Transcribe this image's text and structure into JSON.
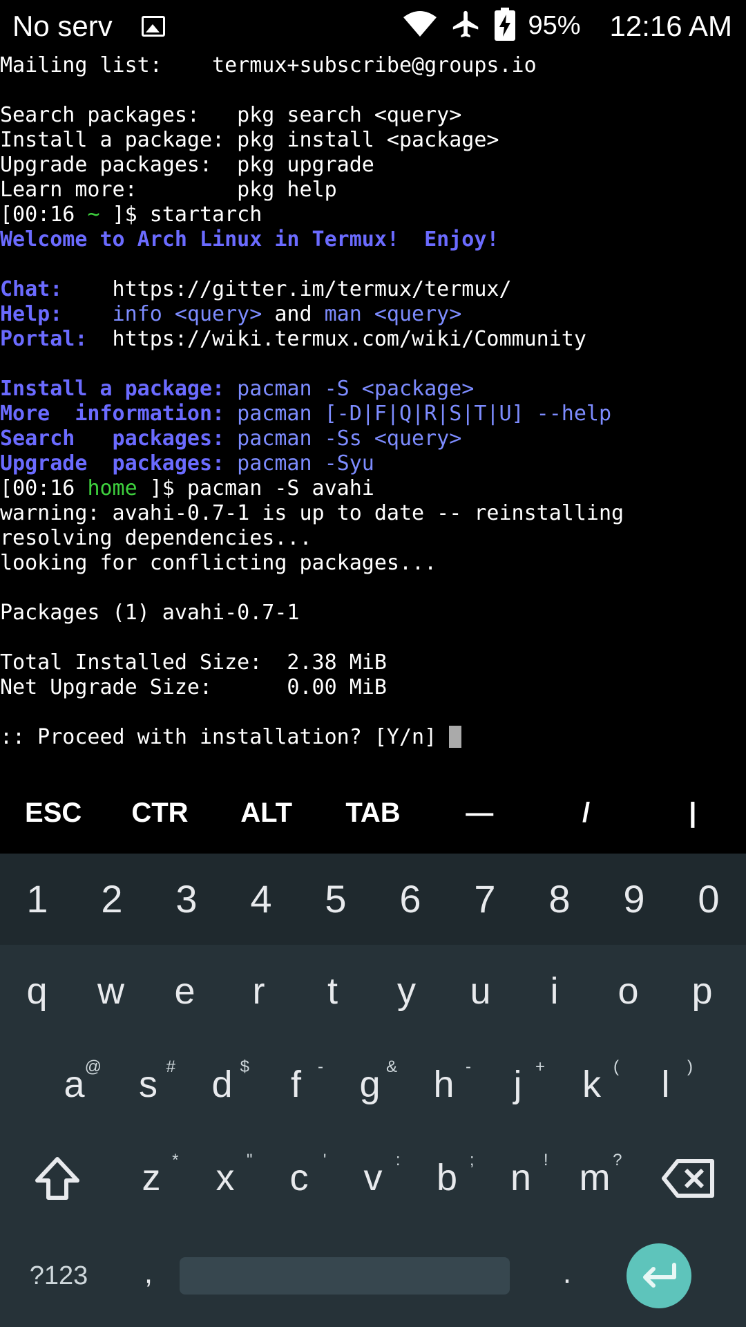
{
  "status_bar": {
    "carrier": "No service",
    "battery_percent": "95%",
    "time": "12:16 AM",
    "icons": [
      "image-icon",
      "wifi-icon",
      "airplane-icon",
      "battery-charging-icon"
    ]
  },
  "terminal": {
    "lines": [
      [
        {
          "t": "Mailing list:    termux+subscribe@groups.io",
          "c": ""
        }
      ],
      [
        {
          "t": "",
          "c": ""
        }
      ],
      [
        {
          "t": "Search packages:   pkg search <query>",
          "c": ""
        }
      ],
      [
        {
          "t": "Install a package: pkg install <package>",
          "c": ""
        }
      ],
      [
        {
          "t": "Upgrade packages:  pkg upgrade",
          "c": ""
        }
      ],
      [
        {
          "t": "Learn more:        pkg help",
          "c": ""
        }
      ],
      [
        {
          "t": "[00:16 ",
          "c": ""
        },
        {
          "t": "~",
          "c": "c-green"
        },
        {
          "t": " ]$ startarch",
          "c": ""
        }
      ],
      [
        {
          "t": "Welcome to Arch Linux in Termux!  Enjoy!",
          "c": "c-blue"
        }
      ],
      [
        {
          "t": "",
          "c": ""
        }
      ],
      [
        {
          "t": "Chat:",
          "c": "c-blue"
        },
        {
          "t": "    https://gitter.im/termux/termux/",
          "c": ""
        }
      ],
      [
        {
          "t": "Help:",
          "c": "c-blue"
        },
        {
          "t": "    ",
          "c": ""
        },
        {
          "t": "info <query>",
          "c": "c-lblue"
        },
        {
          "t": " and ",
          "c": ""
        },
        {
          "t": "man <query>",
          "c": "c-lblue"
        }
      ],
      [
        {
          "t": "Portal:",
          "c": "c-blue"
        },
        {
          "t": "  https://wiki.termux.com/wiki/Community",
          "c": ""
        }
      ],
      [
        {
          "t": "",
          "c": ""
        }
      ],
      [
        {
          "t": "Install a package:",
          "c": "c-blue"
        },
        {
          "t": " pacman -S <package>",
          "c": "c-lblue"
        }
      ],
      [
        {
          "t": "More  information:",
          "c": "c-blue"
        },
        {
          "t": " pacman [-D|F|Q|R|S|T|U] --help",
          "c": "c-lblue"
        }
      ],
      [
        {
          "t": "Search   packages:",
          "c": "c-blue"
        },
        {
          "t": " pacman -Ss <query>",
          "c": "c-lblue"
        }
      ],
      [
        {
          "t": "Upgrade  packages:",
          "c": "c-blue"
        },
        {
          "t": " pacman -Syu",
          "c": "c-lblue"
        }
      ],
      [
        {
          "t": "[00:16 ",
          "c": ""
        },
        {
          "t": "home",
          "c": "c-green"
        },
        {
          "t": " ]$ pacman -S avahi",
          "c": ""
        }
      ],
      [
        {
          "t": "warning: avahi-0.7-1 is up to date -- reinstalling",
          "c": ""
        }
      ],
      [
        {
          "t": "resolving dependencies...",
          "c": ""
        }
      ],
      [
        {
          "t": "looking for conflicting packages...",
          "c": ""
        }
      ],
      [
        {
          "t": "",
          "c": ""
        }
      ],
      [
        {
          "t": "Packages (1) avahi-0.7-1",
          "c": ""
        }
      ],
      [
        {
          "t": "",
          "c": ""
        }
      ],
      [
        {
          "t": "Total Installed Size:  2.38 MiB",
          "c": ""
        }
      ],
      [
        {
          "t": "Net Upgrade Size:      0.00 MiB",
          "c": ""
        }
      ],
      [
        {
          "t": "",
          "c": ""
        }
      ],
      [
        {
          "t": ":: Proceed with installation? [Y/n] ",
          "c": ""
        }
      ]
    ]
  },
  "extra_keys": [
    "ESC",
    "CTR",
    "ALT",
    "TAB",
    "—",
    "/",
    "|"
  ],
  "keyboard": {
    "numbers": [
      "1",
      "2",
      "3",
      "4",
      "5",
      "6",
      "7",
      "8",
      "9",
      "0"
    ],
    "row1": [
      "q",
      "w",
      "e",
      "r",
      "t",
      "y",
      "u",
      "i",
      "o",
      "p"
    ],
    "row2": [
      {
        "k": "a",
        "s": "@"
      },
      {
        "k": "s",
        "s": "#"
      },
      {
        "k": "d",
        "s": "$"
      },
      {
        "k": "f",
        "s": "-"
      },
      {
        "k": "g",
        "s": "&"
      },
      {
        "k": "h",
        "s": "-"
      },
      {
        "k": "j",
        "s": "+"
      },
      {
        "k": "k",
        "s": "("
      },
      {
        "k": "l",
        "s": ")"
      }
    ],
    "row3": [
      {
        "k": "z",
        "s": "*"
      },
      {
        "k": "x",
        "s": "\""
      },
      {
        "k": "c",
        "s": "'"
      },
      {
        "k": "v",
        "s": ":"
      },
      {
        "k": "b",
        "s": ";"
      },
      {
        "k": "n",
        "s": "!"
      },
      {
        "k": "m",
        "s": "?"
      }
    ],
    "symbols_label": "?123",
    "comma": ",",
    "period": "."
  }
}
